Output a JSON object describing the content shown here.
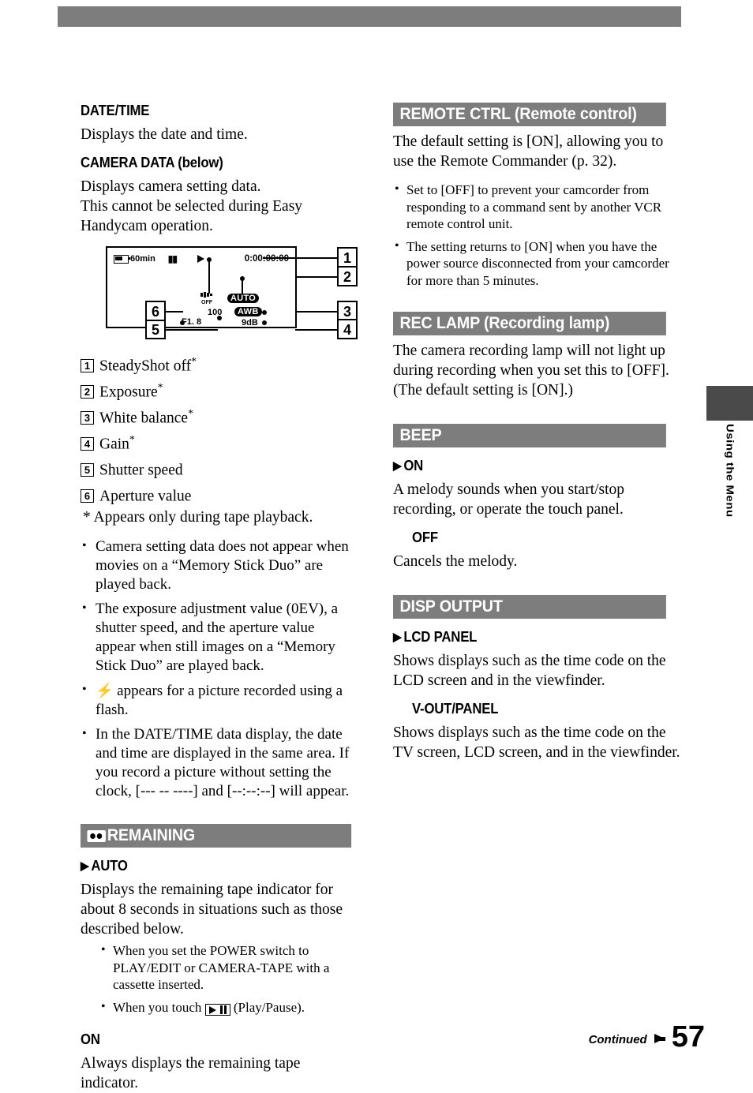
{
  "page": {
    "number": "57",
    "continued_label": "Continued",
    "side_tab_label": "Using the Menu",
    "header_band_color": "#7d7d7d"
  },
  "left_column": {
    "date_time": {
      "heading": "DATE/TIME",
      "body": "Displays the date and time."
    },
    "camera_data": {
      "heading": "CAMERA DATA (below)",
      "body1": "Displays camera setting data.",
      "body2": "This cannot be selected during Easy Handycam operation."
    },
    "lcd_diagram": {
      "battery_time": "60min",
      "memory_icon": "memory-stick-icon",
      "play_icon": "play-icon",
      "timecode": "0:00:00:00",
      "steadyshot_off": "OFF",
      "exposure_tag": "AUTO",
      "white_balance_tag": "AWB",
      "gain": "9dB",
      "shutter": "100",
      "aperture": "F1. 8",
      "callouts": [
        "1",
        "2",
        "3",
        "4",
        "5",
        "6"
      ]
    },
    "numbered_items": [
      {
        "num": "1",
        "label": "SteadyShot off",
        "star": "*"
      },
      {
        "num": "2",
        "label": "Exposure",
        "star": "*"
      },
      {
        "num": "3",
        "label": "White balance",
        "star": "*"
      },
      {
        "num": "4",
        "label": "Gain",
        "star": "*"
      },
      {
        "num": "5",
        "label": "Shutter speed",
        "star": ""
      },
      {
        "num": "6",
        "label": "Aperture value",
        "star": ""
      }
    ],
    "footnote": "* Appears only during tape playback.",
    "bullets": [
      "Camera setting data does not appear when movies on a “Memory Stick Duo” are played back.",
      "The exposure adjustment value (0EV), a shutter speed, and the aperture value appear when still images on a “Memory Stick Duo” are played back.",
      "appears for a picture recorded using a flash.",
      "In the DATE/TIME data display, the date and time are displayed in the same area. If you record a picture without setting the clock, [--- -- ----] and [--:--:--] will appear."
    ],
    "remaining": {
      "heading": "REMAINING",
      "icon": "cassette-icon",
      "auto": {
        "label": "AUTO",
        "marker": "▶",
        "body": "Displays the remaining tape indicator for about 8 seconds in situations such as those described below.",
        "bullets_pre": "When you set the POWER switch to PLAY/EDIT or CAMERA-TAPE with a cassette inserted.",
        "bullet_touch_pre": "When you touch",
        "bullet_touch_post": "(Play/Pause)."
      },
      "on": {
        "label": "ON",
        "body": "Always displays the remaining tape indicator."
      }
    }
  },
  "right_column": {
    "remote_ctrl": {
      "heading": "REMOTE CTRL (Remote control)",
      "body": "The default setting is [ON], allowing you to use the Remote Commander (p. 32).",
      "bullets": [
        "Set to [OFF] to prevent your camcorder from responding to a command sent by another VCR remote control unit.",
        "The setting returns to [ON] when you have the power source disconnected from your camcorder for more than 5 minutes."
      ]
    },
    "rec_lamp": {
      "heading": "REC LAMP (Recording lamp)",
      "body": "The camera recording lamp will not light up during recording when you set this to [OFF]. (The default setting is [ON].)"
    },
    "beep": {
      "heading": "BEEP",
      "on": {
        "label": "ON",
        "marker": "▶",
        "body": "A melody sounds when you start/stop recording, or operate the touch panel."
      },
      "off": {
        "label": "OFF",
        "body": "Cancels the melody."
      }
    },
    "disp_output": {
      "heading": "DISP OUTPUT",
      "lcd_panel": {
        "label": "LCD PANEL",
        "marker": "▶",
        "body": "Shows displays such as the time code on the LCD screen and in the viewfinder."
      },
      "v_out_panel": {
        "label": "V-OUT/PANEL",
        "body": "Shows displays such as the time code on the TV screen, LCD screen, and in the viewfinder."
      }
    }
  }
}
